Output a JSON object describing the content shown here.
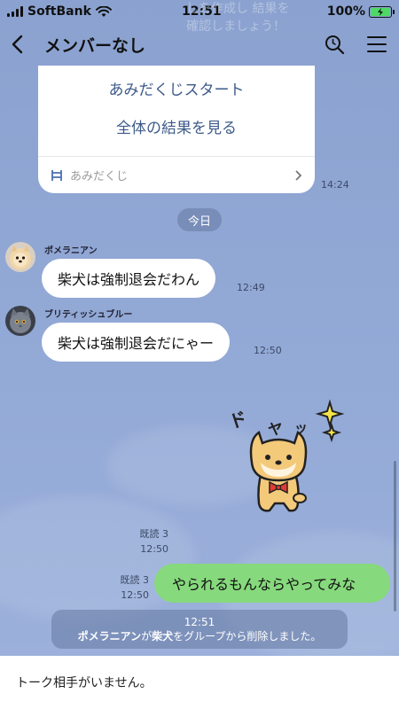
{
  "status_bar": {
    "carrier": "SoftBank",
    "time": "12:51",
    "battery": "100%"
  },
  "header": {
    "title": "メンバーなし",
    "ghost_line1": "しを作成し   結果を",
    "ghost_line2": "確認しましょう！"
  },
  "card": {
    "link1": "あみだくじスタート",
    "link2": "全体の結果を見る",
    "footer_label": "あみだくじ",
    "time": "14:24"
  },
  "date_pill": "今日",
  "messages": [
    {
      "sender": "ポメラニアン",
      "text": "柴犬は強制退会だわん",
      "time": "12:49"
    },
    {
      "sender": "ブリティッシュブルー",
      "text": "柴犬は強制退会だにゃー",
      "time": "12:50"
    }
  ],
  "sticker": {
    "text_do": "ド",
    "text_ya1": "ヤ",
    "text_ya2": "ッ",
    "read": "既読 3",
    "time": "12:50"
  },
  "outgoing": {
    "text": "やられるもんならやってみな",
    "read": "既読 3",
    "time": "12:50"
  },
  "system": {
    "time": "12:51",
    "actor": "ポメラニアン",
    "particle1": "が",
    "target": "柴犬",
    "rest": "をグループから削除しました。"
  },
  "bottom_bar": {
    "text": "トーク相手がいません。"
  },
  "colors": {
    "chat_bg": "#8fa6d4",
    "outgoing_bubble": "#86d97c",
    "link": "#3e5b8a",
    "battery_fill": "#4cd964"
  }
}
